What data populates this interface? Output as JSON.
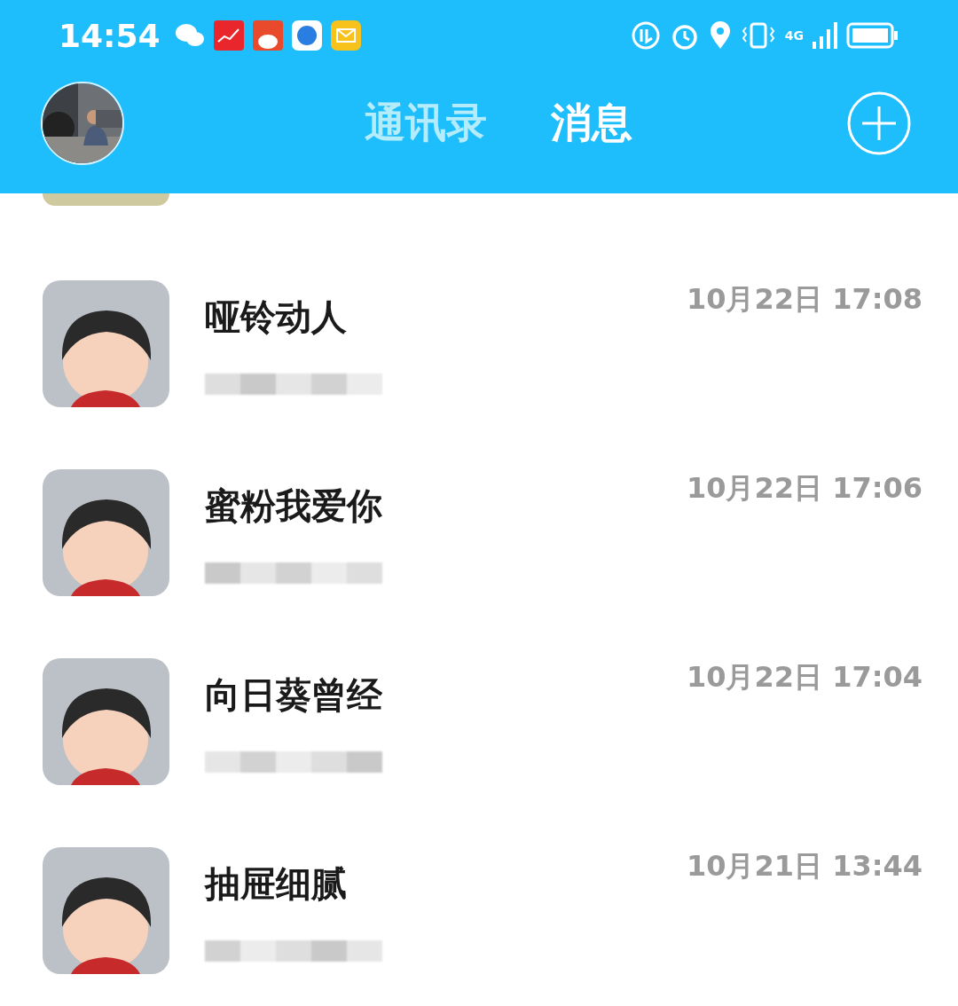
{
  "status_bar": {
    "time": "14:54",
    "network": "4G"
  },
  "header": {
    "tabs": [
      {
        "label": "通讯录",
        "selected": false
      },
      {
        "label": "消息",
        "selected": true
      }
    ]
  },
  "conversations": [
    {
      "name": "哑铃动人",
      "time": "10月22日 17:08"
    },
    {
      "name": "蜜粉我爱你",
      "time": "10月22日 17:06"
    },
    {
      "name": "向日葵曾经",
      "time": "10月22日 17:04"
    },
    {
      "name": "抽屉细腻",
      "time": "10月21日 13:44"
    }
  ]
}
